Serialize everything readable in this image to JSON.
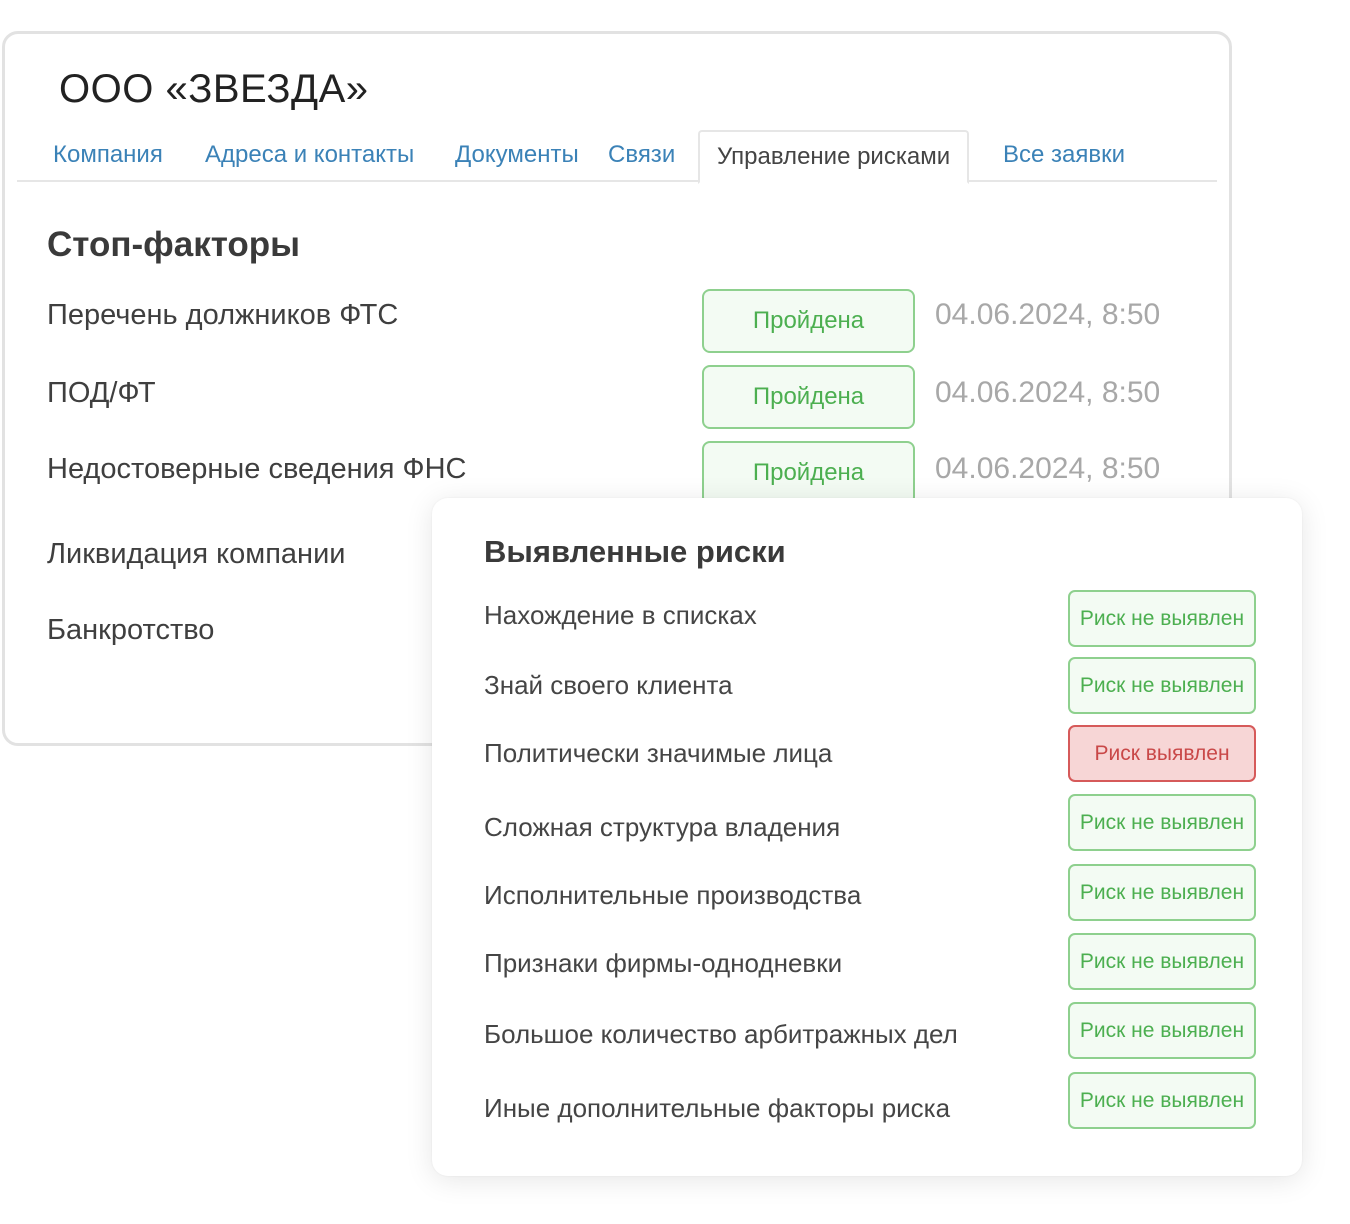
{
  "company": {
    "title": "ООО «ЗВЕЗДА»"
  },
  "tabs": [
    {
      "label": "Компания"
    },
    {
      "label": "Адреса и контакты"
    },
    {
      "label": "Документы"
    },
    {
      "label": "Связи"
    },
    {
      "label": "Управление рисками",
      "active": true
    },
    {
      "label": "Все заявки"
    }
  ],
  "stop_factors": {
    "title": "Стоп-факторы",
    "rows": [
      {
        "label": "Перечень должников ФТС",
        "status": "Пройдена",
        "date": "04.06.2024, 8:50"
      },
      {
        "label": "ПОД/ФТ",
        "status": "Пройдена",
        "date": "04.06.2024, 8:50"
      },
      {
        "label": "Недостоверные сведения ФНС",
        "status": "Пройдена",
        "date": "04.06.2024, 8:50"
      },
      {
        "label": "Ликвидация компании"
      },
      {
        "label": "Банкротство"
      }
    ]
  },
  "risks": {
    "title": "Выявленные риски",
    "rows": [
      {
        "label": "Нахождение в списках",
        "status": "Риск не выявлен",
        "detected": false
      },
      {
        "label": "Знай своего клиента",
        "status": "Риск не выявлен",
        "detected": false
      },
      {
        "label": "Политически значимые лица",
        "status": "Риск выявлен",
        "detected": true
      },
      {
        "label": "Сложная структура владения",
        "status": "Риск не выявлен",
        "detected": false
      },
      {
        "label": "Исполнительные производства",
        "status": "Риск не выявлен",
        "detected": false
      },
      {
        "label": "Признаки фирмы-однодневки",
        "status": "Риск не выявлен",
        "detected": false
      },
      {
        "label": "Большое количество арбитражных дел",
        "status": "Риск не выявлен",
        "detected": false
      },
      {
        "label": "Иные дополнительные факторы риска",
        "status": "Риск не выявлен",
        "detected": false
      }
    ]
  },
  "colors": {
    "link": "#3b82b7",
    "success_border": "#8ed08e",
    "success_text": "#4caf50",
    "danger_border": "#d65a5a",
    "danger_bg": "#f7d6d6"
  }
}
